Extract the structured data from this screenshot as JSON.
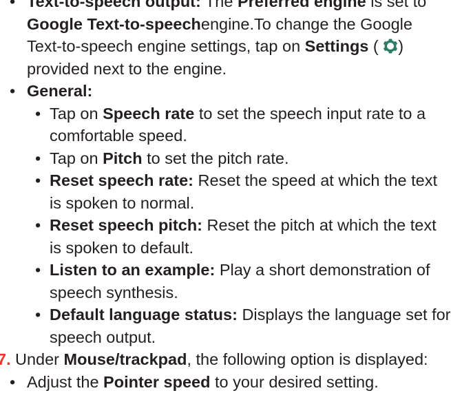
{
  "colors": {
    "accent": "#2e7d66",
    "step_number": "#e8392e",
    "text": "#231f20"
  },
  "tts": {
    "label": "Text-to-speech output:",
    "t1": "The",
    "b1": "Preferred engine",
    "t2": "is set to",
    "b2": "Google Text-to-speech",
    "t3": "engine.To change the Google Text-to-speech engine settings, tap on",
    "b3": "Settings",
    "t4": "(",
    "t5": ") provided next to the engine.",
    "icon": "gear-icon"
  },
  "general": {
    "label": "General:",
    "items": [
      {
        "t1": "Tap on",
        "b1": "Speech rate",
        "t2": "to set the speech input rate to a comfortable speed."
      },
      {
        "t1": "Tap on",
        "b1": "Pitch",
        "t2": "to set the pitch rate."
      },
      {
        "b1": "Reset speech rate:",
        "t2": "Reset the speed at which the text is spoken to normal."
      },
      {
        "b1": "Reset speech pitch:",
        "t2": "Reset the pitch at which the text is spoken to default."
      },
      {
        "b1": "Listen to an example:",
        "t2": "Play a short demonstration of speech synthesis."
      },
      {
        "b1": "Default language status:",
        "t2": "Displays the language set for speech output."
      }
    ]
  },
  "step": {
    "number": "7.",
    "t1": "Under",
    "b1": "Mouse/trackpad",
    "t2": ", the following option is displayed:"
  },
  "pointer": {
    "t1": "Adjust the",
    "b1": "Pointer speed",
    "t2": "to your desired setting."
  }
}
